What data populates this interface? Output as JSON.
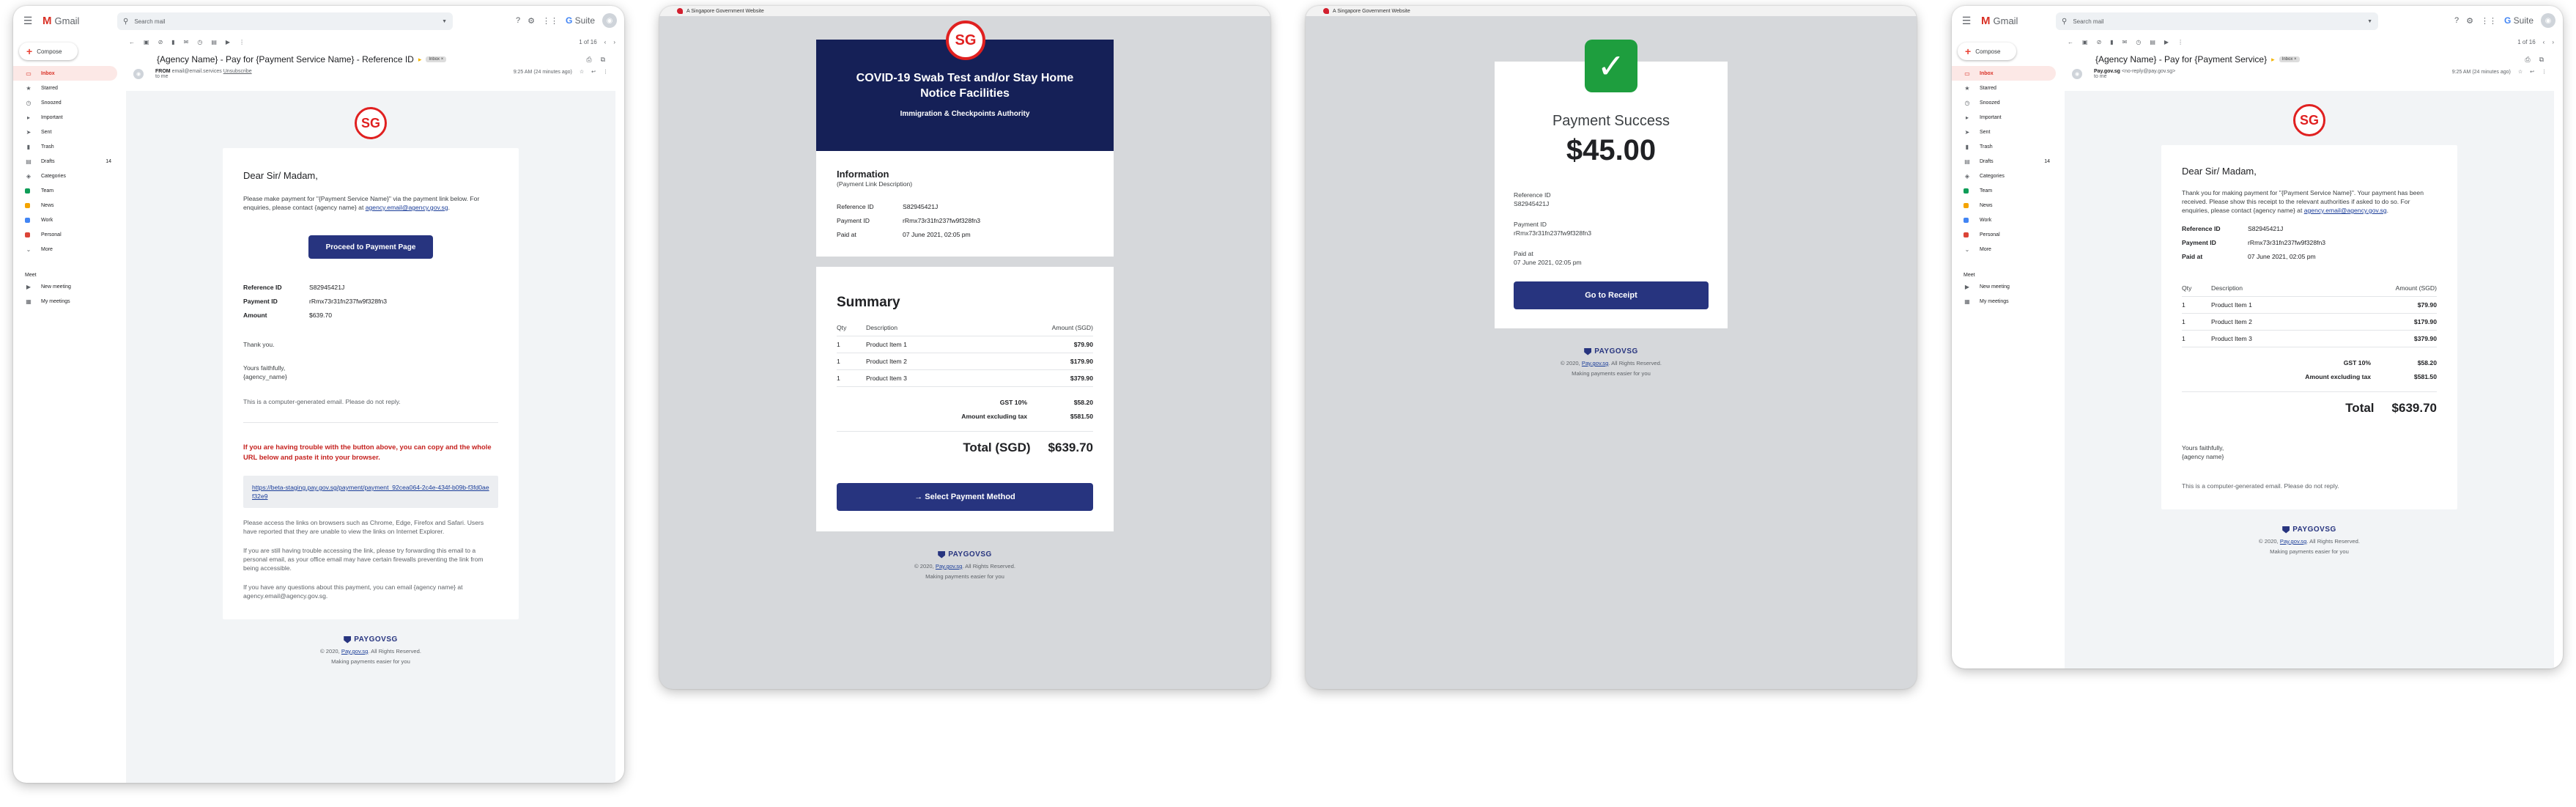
{
  "gmail": {
    "app_name": "Gmail",
    "search_placeholder": "Search mail",
    "suite_label": "Suite",
    "compose_label": "Compose",
    "nav": [
      {
        "label": "Inbox",
        "icon": "inbox-icon",
        "glyph": "▭",
        "active": true,
        "count": ""
      },
      {
        "label": "Starred",
        "icon": "star-icon",
        "glyph": "★",
        "count": ""
      },
      {
        "label": "Snoozed",
        "icon": "clock-icon",
        "glyph": "◷",
        "count": ""
      },
      {
        "label": "Important",
        "icon": "important-icon",
        "glyph": "▸",
        "count": ""
      },
      {
        "label": "Sent",
        "icon": "send-icon",
        "glyph": "➤",
        "count": ""
      },
      {
        "label": "Trash",
        "icon": "trash-icon",
        "glyph": "▮",
        "count": ""
      },
      {
        "label": "Drafts",
        "icon": "draft-icon",
        "glyph": "▤",
        "count": "14"
      },
      {
        "label": "Categories",
        "icon": "category-icon",
        "glyph": "◈",
        "count": ""
      }
    ],
    "labels": [
      {
        "label": "Team",
        "color": "#0f9d58"
      },
      {
        "label": "News",
        "color": "#f4a400"
      },
      {
        "label": "Work",
        "color": "#4285f4"
      },
      {
        "label": "Personal",
        "color": "#db4437"
      }
    ],
    "more_label": "More",
    "meet_heading": "Meet",
    "meet_items": [
      "New meeting",
      "My meetings"
    ],
    "pager": "1 of 16"
  },
  "email1": {
    "subject": "{Agency Name} - Pay for {Payment Service Name} - Reference ID",
    "inbox_label": "Inbox ×",
    "sender_from": "FROM",
    "sender_addr": "email@email.services",
    "sender_unsub": "Unsubscribe",
    "sender_to": "to me",
    "time": "9:25 AM (24 minutes ago)",
    "greeting": "Dear Sir/ Madam,",
    "intro_1": "Please make payment for \"{Payment Service Name}\" via the payment link below. For enquiries, please contact {agency name} at",
    "intro_email": "agency.email@agency.gov.sg",
    "button": "Proceed to Payment Page",
    "details": [
      {
        "k": "Reference ID",
        "v": "S82945421J"
      },
      {
        "k": "Payment ID",
        "v": "rRmx73r31fn237fw9f328fn3"
      },
      {
        "k": "Amount",
        "v": "$639.70"
      }
    ],
    "thanks": "Thank you.",
    "yours": "Yours faithfully,",
    "agency": "{agency_name}",
    "auto": "This is a computer-generated email. Please do not reply.",
    "trouble": "If you are having trouble with the button above, you can copy and the whole URL below and paste it into your browser.",
    "url": "https://beta-staging.pay.gov.sg/payment/payment_92cea064-2c4e-434f-b09b-f3fd0aef32e9",
    "note_1": "Please access the links on browsers such as Chrome, Edge, Firefox and Safari. Users have reported that they are unable to view the links on Internet Explorer.",
    "note_2": "If you are still having trouble accessing the link, please try forwarding this email to a personal email, as your office email may have certain firewalls preventing the link from being accessible.",
    "note_3": "If you have any questions about this payment, you can email {agency name} at agency.email@agency.gov.sg."
  },
  "footer": {
    "brand": "PAYGOVSG",
    "copyright_pre": "© 2020,",
    "copyright_link": "Pay.gov.sg",
    "copyright_post": ". All Rights Reserved.",
    "tagline": "Making payments easier for you"
  },
  "pay_page": {
    "gov_banner": "A Singapore Government Website",
    "logo_text": "SG",
    "title": "COVID-19 Swab Test and/or Stay Home Notice Facilities",
    "agency": "Immigration & Checkpoints Authority",
    "info_heading": "Information",
    "info_sub": "(Payment Link Description)",
    "info_rows": [
      {
        "k": "Reference ID",
        "v": "S82945421J"
      },
      {
        "k": "Payment ID",
        "v": "rRmx73r31fn237fw9f328fn3"
      },
      {
        "k": "Paid at",
        "v": "07 June 2021, 02:05 pm"
      }
    ],
    "summary_heading": "Summary",
    "col_qty": "Qty",
    "col_desc": "Description",
    "col_amt": "Amount (SGD)",
    "items": [
      {
        "q": "1",
        "d": "Product Item 1",
        "a": "$79.90"
      },
      {
        "q": "1",
        "d": "Product Item 2",
        "a": "$179.90"
      },
      {
        "q": "1",
        "d": "Product Item 3",
        "a": "$379.90"
      }
    ],
    "gst_label": "GST 10%",
    "gst_value": "$58.20",
    "excl_label": "Amount excluding tax",
    "excl_value": "$581.50",
    "total_label": "Total (SGD)",
    "total_value": "$639.70",
    "button": "→  Select Payment Method"
  },
  "success_page": {
    "gov_banner": "A Singapore Government Website",
    "title": "Payment Success",
    "amount": "$45.00",
    "rows": [
      {
        "k": "Reference ID",
        "v": "S82945421J"
      },
      {
        "k": "Payment ID",
        "v": "rRmx73r31fn237fw9f328fn3"
      },
      {
        "k": "Paid at",
        "v": "07 June 2021, 02:05 pm"
      }
    ],
    "button": "Go to Receipt"
  },
  "email2": {
    "subject": "{Agency Name} - Pay for {Payment Service}",
    "inbox_label": "Inbox ×",
    "sender_name": "Pay.gov.sg",
    "sender_addr": "<no-reply@pay.gov.sg>",
    "sender_to": "to me",
    "time": "9:25 AM (24 minutes ago)",
    "greeting": "Dear Sir/ Madam,",
    "intro_1": "Thank you for making payment for \"{Payment Service Name}\". Your payment has been received. Please show this receipt to the relevant authorities if asked to do so. For enquiries, please contact {agency name} at",
    "intro_email": "agency.email@agency.gov.sg",
    "details": [
      {
        "k": "Reference ID",
        "v": "S82945421J"
      },
      {
        "k": "Payment ID",
        "v": "rRmx73r31fn237fw9f328fn3"
      },
      {
        "k": "Paid at",
        "v": "07 June 2021, 02:05 pm"
      }
    ],
    "col_qty": "Qty",
    "col_desc": "Description",
    "col_amt": "Amount (SGD)",
    "items": [
      {
        "q": "1",
        "d": "Product Item 1",
        "a": "$79.90"
      },
      {
        "q": "1",
        "d": "Product Item 2",
        "a": "$179.90"
      },
      {
        "q": "1",
        "d": "Product Item 3",
        "a": "$379.90"
      }
    ],
    "gst_label": "GST 10%",
    "gst_value": "$58.20",
    "excl_label": "Amount excluding tax",
    "excl_value": "$581.50",
    "total_label": "Total",
    "total_value": "$639.70",
    "yours": "Yours faithfully,",
    "agency": "{agency name}",
    "auto": "This is a computer-generated email. Please do not reply."
  },
  "colors": {
    "navy": "#27347f",
    "red": "#e02020",
    "success_green": "#1e9e3e",
    "warning_red": "#c5221f"
  }
}
